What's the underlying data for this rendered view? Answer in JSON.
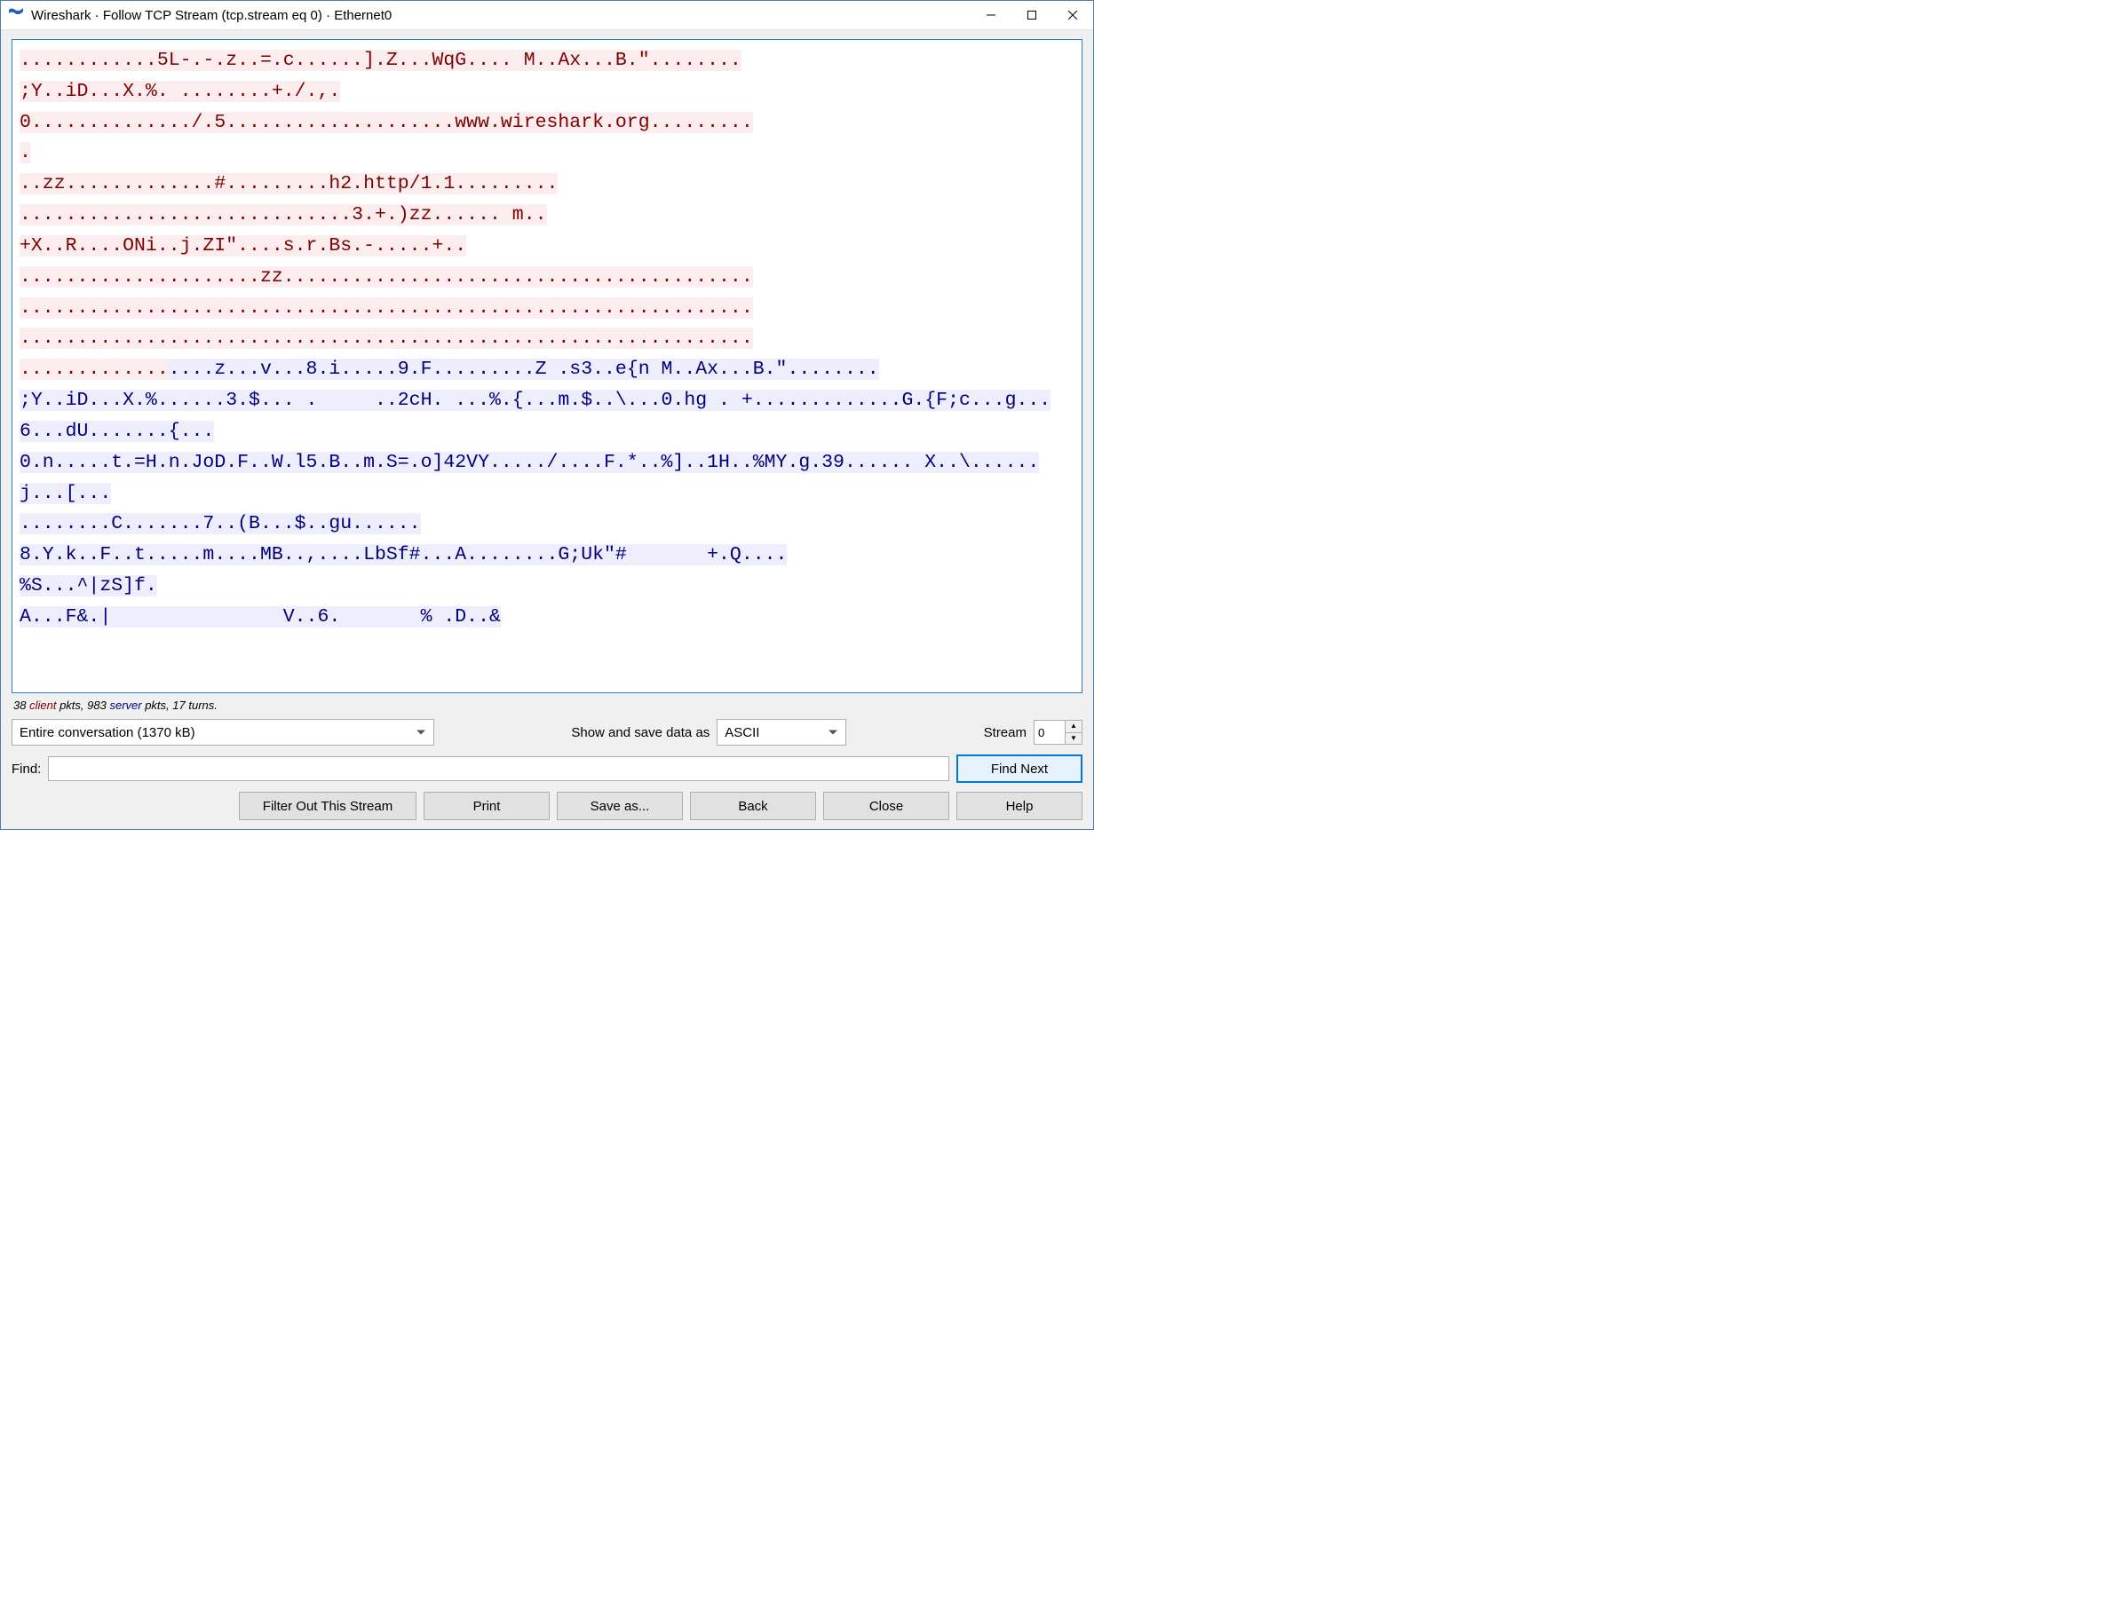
{
  "window": {
    "title": "Wireshark · Follow TCP Stream (tcp.stream eq 0) · Ethernet0"
  },
  "stream": {
    "segments": [
      {
        "who": "client",
        "text": "............5L-.-.z..=.c......].Z...WqG.... M..Ax...B.\"........\n;Y..iD...X.%. ........+./.,."
      },
      {
        "who": "client",
        "text": "\n0............../.5....................www.wireshark.org.........\n."
      },
      {
        "who": "client",
        "text": "\n..zz.............#.........h2.http/1.1.........\n.............................3.+.)zz...... m..\n+X..R....ONi..j.ZI\"....s.r.Bs.-.....+.."
      },
      {
        "who": "client",
        "text": "\n.....................zz.........................................\n................................................................\n................................................................\n............."
      },
      {
        "who": "server",
        "text": "....z...v...8.i.....9.F.........Z .s3..e{n M..Ax...B.\"........\n;Y..iD...X.%......3.$... .     ..2cH. ...%.{...m.$..\\...0.hg . +.............G.{F;c...g...6...dU.......{...\n0.n.....t.=H.n.JoD.F..W.l5.B..m.S=.o]42VY...../....F.*..%]..1H..%MY.g.39...... X..\\......j...[...\n........C.......7..(B...$..gu......\n8.Y.k..F..t.....m....MB..,....LbSf#...A........G;Uk\"#       +.Q....\n%S...^|zS]f."
      },
      {
        "who": "server",
        "text": "\nA...F&.|               V..6.       % .D..&"
      }
    ]
  },
  "stats": {
    "client_pkts": "38",
    "client_word": "client",
    "mid1": " pkts, ",
    "server_pkts": "983",
    "server_word": "server",
    "mid2": " pkts, ",
    "turns": "17 turns."
  },
  "controls": {
    "conversation_selected": "Entire conversation (1370 kB)",
    "show_save_label": "Show and save data as",
    "encoding_selected": "ASCII",
    "stream_label": "Stream",
    "stream_value": "0"
  },
  "find": {
    "label": "Find:",
    "value": "",
    "button": "Find Next"
  },
  "buttons": {
    "filter_out": "Filter Out This Stream",
    "print": "Print",
    "save_as": "Save as...",
    "back": "Back",
    "close": "Close",
    "help": "Help"
  }
}
